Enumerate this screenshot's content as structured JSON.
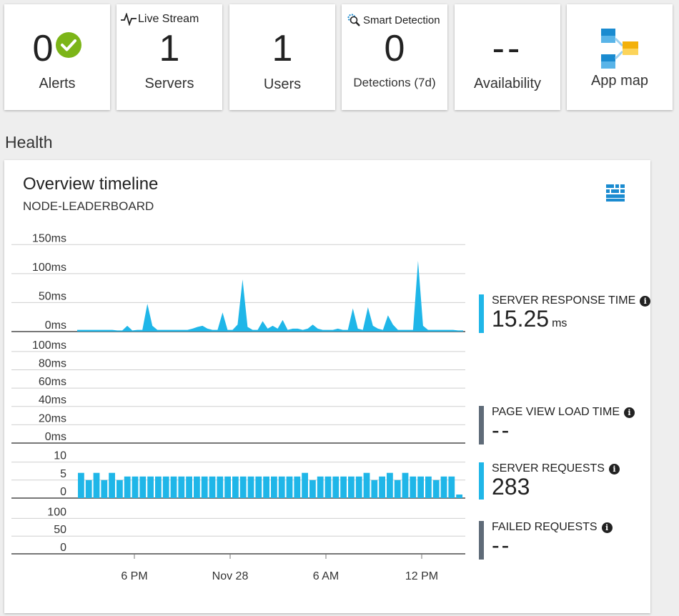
{
  "tiles": {
    "alerts": {
      "value": "0",
      "label": "Alerts"
    },
    "live_stream": {
      "header": "Live Stream",
      "value": "1",
      "label": "Servers"
    },
    "users": {
      "value": "1",
      "label": "Users"
    },
    "smart_detection": {
      "header": "Smart Detection",
      "value": "0",
      "label": "Detections (7d)"
    },
    "availability": {
      "value": "--",
      "label": "Availability"
    },
    "app_map": {
      "label": "App map"
    }
  },
  "section_title": "Health",
  "panel": {
    "title": "Overview timeline",
    "subtitle": "NODE-LEADERBOARD"
  },
  "colors": {
    "accent": "#1fb6e8",
    "grey_bar": "#5f6b78",
    "alert_green": "#7cb518"
  },
  "metrics": [
    {
      "name": "SERVER RESPONSE TIME",
      "value": "15.25",
      "unit": "ms",
      "color": "#1fb6e8"
    },
    {
      "name": "PAGE VIEW LOAD TIME",
      "value": "--",
      "unit": "",
      "color": "#5f6b78"
    },
    {
      "name": "SERVER REQUESTS",
      "value": "283",
      "unit": "",
      "color": "#1fb6e8"
    },
    {
      "name": "FAILED REQUESTS",
      "value": "--",
      "unit": "",
      "color": "#5f6b78"
    }
  ],
  "chart_data": [
    {
      "type": "area",
      "name": "SERVER RESPONSE TIME",
      "ylim": [
        0,
        150
      ],
      "ticks": [
        "150ms",
        "100ms",
        "50ms",
        "0ms"
      ],
      "values": [
        3,
        3,
        3,
        3,
        3,
        3,
        3,
        3,
        2,
        2,
        10,
        2,
        3,
        3,
        48,
        10,
        3,
        3,
        3,
        3,
        3,
        3,
        3,
        5,
        8,
        10,
        5,
        3,
        3,
        33,
        3,
        3,
        12,
        90,
        8,
        3,
        3,
        18,
        5,
        10,
        5,
        20,
        3,
        5,
        5,
        3,
        5,
        12,
        5,
        3,
        3,
        3,
        5,
        3,
        3,
        40,
        5,
        3,
        42,
        10,
        5,
        3,
        28,
        12,
        3,
        3,
        3,
        3,
        122,
        10,
        3,
        3,
        3,
        3,
        3,
        3,
        2,
        2
      ]
    },
    {
      "type": "area",
      "name": "PAGE VIEW LOAD TIME",
      "ylim": [
        0,
        100
      ],
      "ticks": [
        "100ms",
        "80ms",
        "60ms",
        "40ms",
        "20ms",
        "0ms"
      ],
      "values": []
    },
    {
      "type": "bar",
      "name": "SERVER REQUESTS",
      "ylim": [
        0,
        10
      ],
      "ticks": [
        "10",
        "5",
        "0"
      ],
      "values": [
        7,
        5,
        7,
        5,
        7,
        5,
        6,
        6,
        6,
        6,
        6,
        6,
        6,
        6,
        6,
        6,
        6,
        6,
        6,
        6,
        6,
        6,
        6,
        6,
        6,
        6,
        6,
        6,
        6,
        7,
        5,
        6,
        6,
        6,
        6,
        6,
        6,
        7,
        5,
        6,
        7,
        5,
        7,
        6,
        6,
        6,
        5,
        6,
        6,
        1
      ]
    },
    {
      "type": "area",
      "name": "FAILED REQUESTS",
      "ylim": [
        0,
        100
      ],
      "ticks": [
        "100",
        "50",
        "0"
      ],
      "values": []
    }
  ],
  "x_ticks": [
    "6 PM",
    "Nov 28",
    "6 AM",
    "12 PM"
  ]
}
